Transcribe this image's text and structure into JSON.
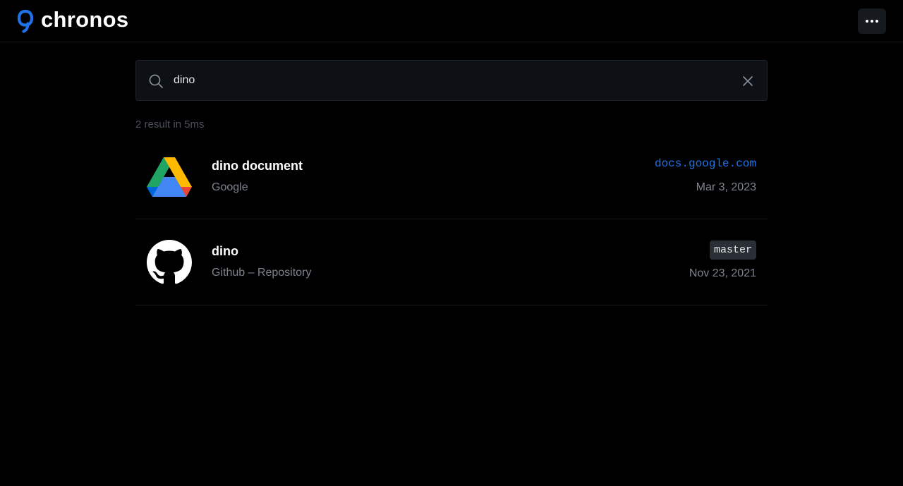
{
  "app": {
    "name": "chronos",
    "brand_color": "#1f73e8"
  },
  "header": {
    "menu_icon": "more-horizontal-icon"
  },
  "search": {
    "value": "dino",
    "placeholder": "",
    "search_icon": "search-icon",
    "clear_icon": "close-icon"
  },
  "results": {
    "summary": "2 result in 5ms",
    "items": [
      {
        "icon": "google-drive-icon",
        "title": "dino document",
        "subtitle": "Google",
        "meta": "docs.google.com",
        "date": "Mar 3, 2023"
      },
      {
        "icon": "github-icon",
        "title": "dino",
        "subtitle": "Github – Repository",
        "badge": "master",
        "date": "Nov 23, 2021"
      }
    ]
  }
}
